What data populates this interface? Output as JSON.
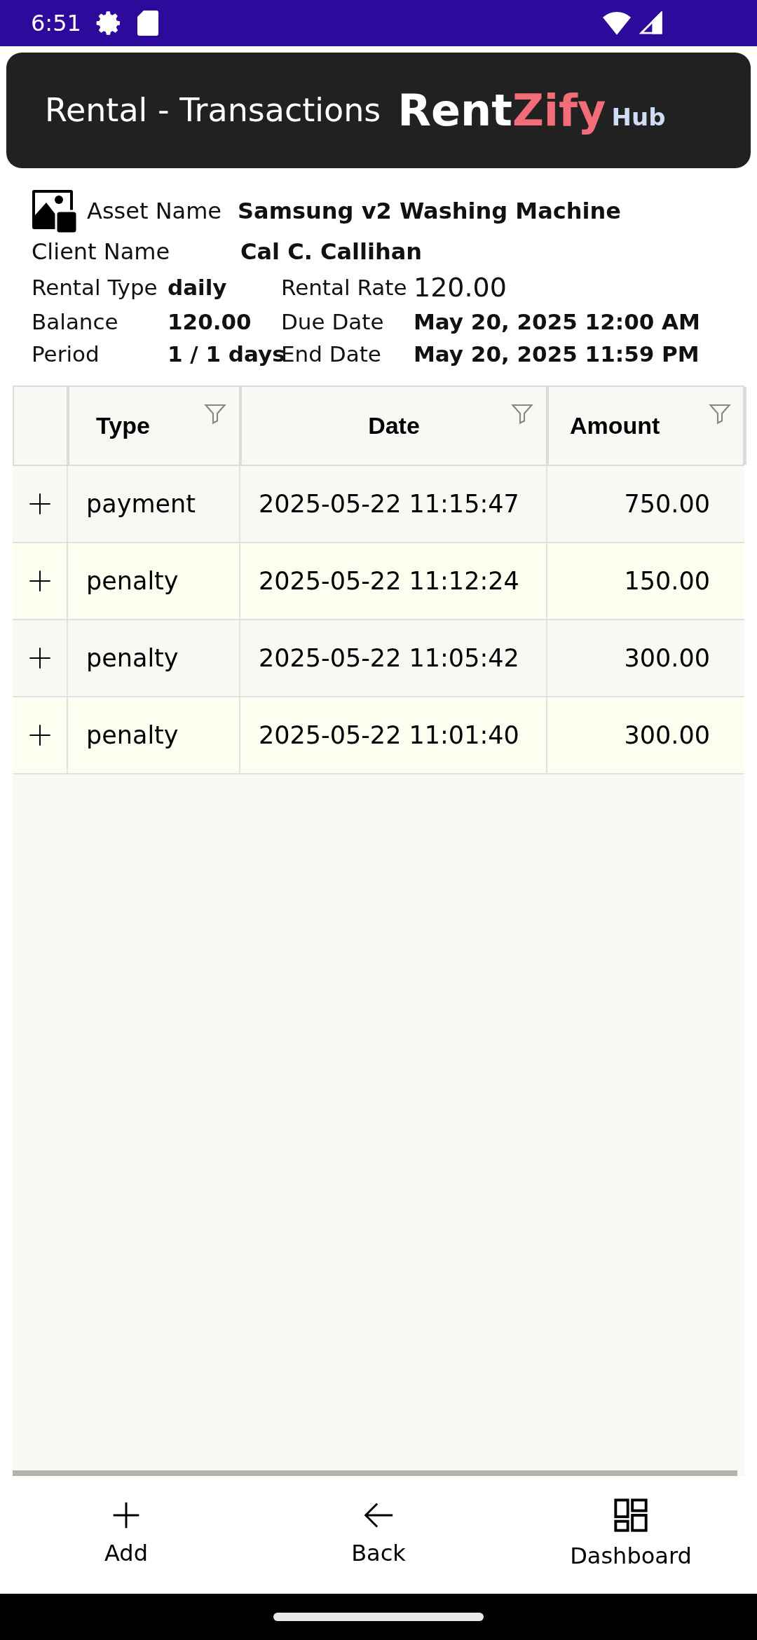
{
  "status_bar": {
    "time": "6:51"
  },
  "header": {
    "title": "Rental - Transactions",
    "logo": {
      "part_1": "Rent",
      "part_2": "Zify",
      "part_3": "Hub"
    }
  },
  "details": {
    "asset_label": "Asset Name",
    "asset_value": "Samsung v2 Washing Machine",
    "client_label": "Client Name",
    "client_value": "Cal C. Callihan",
    "fields": [
      {
        "label": "Rental Type",
        "value": "daily",
        "label_2": "Rental Rate",
        "value_2": "120.00"
      },
      {
        "label": "Balance",
        "value": "120.00",
        "label_2": "Due Date",
        "value_2": "May 20, 2025 12:00 AM"
      },
      {
        "label": "Period",
        "value": "1 / 1 days",
        "label_2": "End Date",
        "value_2": "May 20, 2025 11:59 PM"
      }
    ]
  },
  "table": {
    "columns": [
      "Type",
      "Date",
      "Amount"
    ],
    "rows": [
      {
        "type": "payment",
        "date": "2025-05-22 11:15:47",
        "amount": "750.00"
      },
      {
        "type": "penalty",
        "date": "2025-05-22 11:12:24",
        "amount": "150.00"
      },
      {
        "type": "penalty",
        "date": "2025-05-22 11:05:42",
        "amount": "300.00"
      },
      {
        "type": "penalty",
        "date": "2025-05-22 11:01:40",
        "amount": "300.00"
      }
    ]
  },
  "bottom_nav": [
    {
      "kind": "add",
      "label": "Add"
    },
    {
      "kind": "back",
      "label": "Back"
    },
    {
      "kind": "dashboard",
      "label": "Dashboard"
    }
  ]
}
